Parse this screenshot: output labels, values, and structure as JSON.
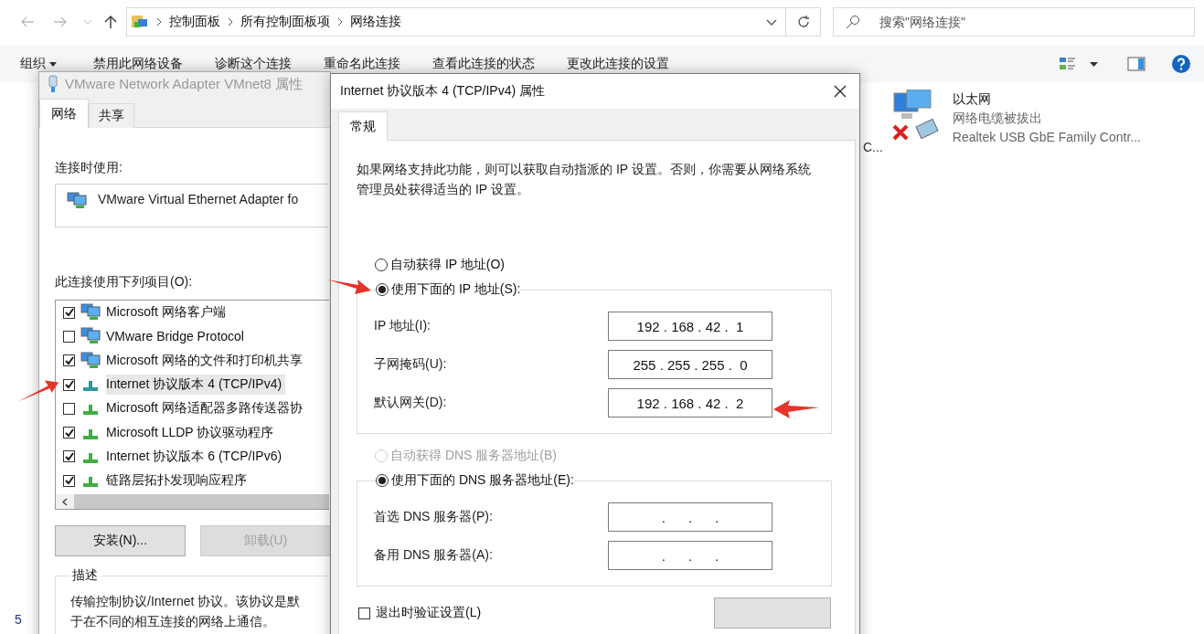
{
  "explorer": {
    "breadcrumbs": [
      "控制面板",
      "所有控制面板项",
      "网络连接"
    ],
    "search": {
      "placeholder": "搜索\"网络连接\""
    },
    "toolbar": [
      {
        "label": "组织",
        "kind": "menu"
      },
      {
        "label": "禁用此网络设备",
        "kind": "command"
      },
      {
        "label": "诊断这个连接",
        "kind": "command"
      },
      {
        "label": "重命名此连接",
        "kind": "command"
      },
      {
        "label": "查看此连接的状态",
        "kind": "command"
      },
      {
        "label": "更改此连接的设置",
        "kind": "command"
      }
    ],
    "hidden_item_fragment": "C...",
    "connection": {
      "name": "以太网",
      "status": "网络电缆被拔出",
      "device": "Realtek USB GbE Family Contr..."
    },
    "status_bar": "5"
  },
  "adapter_dialog": {
    "title": "VMware Network Adapter VMnet8 属性",
    "tabs": [
      {
        "label": "网络",
        "selected": true
      },
      {
        "label": "共享",
        "selected": false
      }
    ],
    "connect_using_label": "连接时使用:",
    "adapter": "VMware Virtual Ethernet Adapter fo",
    "items_label": "此连接使用下列项目(O):",
    "items": [
      {
        "label": "Microsoft 网络客户端",
        "checked": true,
        "selected": false,
        "kind": "client"
      },
      {
        "label": "VMware Bridge Protocol",
        "checked": false,
        "selected": false,
        "kind": "client"
      },
      {
        "label": "Microsoft 网络的文件和打印机共享",
        "checked": true,
        "selected": false,
        "kind": "client"
      },
      {
        "label": "Internet 协议版本 4 (TCP/IPv4)",
        "checked": true,
        "selected": true,
        "kind": "protocol"
      },
      {
        "label": "Microsoft 网络适配器多路传送器协",
        "checked": false,
        "selected": false,
        "kind": "protocol"
      },
      {
        "label": "Microsoft LLDP 协议驱动程序",
        "checked": true,
        "selected": false,
        "kind": "protocol"
      },
      {
        "label": "Internet 协议版本 6 (TCP/IPv6)",
        "checked": true,
        "selected": false,
        "kind": "protocol"
      },
      {
        "label": "链路层拓扑发现响应程序",
        "checked": true,
        "selected": false,
        "kind": "protocol"
      }
    ],
    "buttons": [
      {
        "label": "安装(N)...",
        "disabled": false
      },
      {
        "label": "卸载(U)",
        "disabled": true
      }
    ],
    "description": {
      "legend": "描述",
      "text": "传输控制协议/Internet 协议。该协议是默",
      "text_line_2": "于在不同的相互连接的网络上通信。"
    }
  },
  "ipv4_dialog": {
    "title": "Internet 协议版本 4 (TCP/IPv4) 属性",
    "tabs": [
      {
        "label": "常规",
        "selected": true
      }
    ],
    "intro": "如果网络支持此功能，则可以获取自动指派的 IP 设置。否则，你需要从网络系统管理员处获得适当的 IP 设置。",
    "ip_mode": [
      {
        "label": "自动获得 IP 地址(O)",
        "selected": false,
        "disabled": false
      },
      {
        "label": "使用下面的 IP 地址(S):",
        "selected": true,
        "disabled": false
      }
    ],
    "ip_fields": [
      {
        "label": "IP 地址(I):",
        "value": "192 . 168 . 42 .  1"
      },
      {
        "label": "子网掩码(U):",
        "value": "255 . 255 . 255 .  0"
      },
      {
        "label": "默认网关(D):",
        "value": "192 . 168 . 42 .  2"
      }
    ],
    "dns_mode": [
      {
        "label": "自动获得 DNS 服务器地址(B)",
        "selected": false,
        "disabled": true
      },
      {
        "label": "使用下面的 DNS 服务器地址(E):",
        "selected": true,
        "disabled": false
      }
    ],
    "dns_fields": [
      {
        "label": "首选 DNS 服务器(P):",
        "value": ".      .      ."
      },
      {
        "label": "备用 DNS 服务器(A):",
        "value": ".      .      ."
      }
    ],
    "validate": {
      "label": "退出时验证设置(L)",
      "checked": false
    }
  }
}
